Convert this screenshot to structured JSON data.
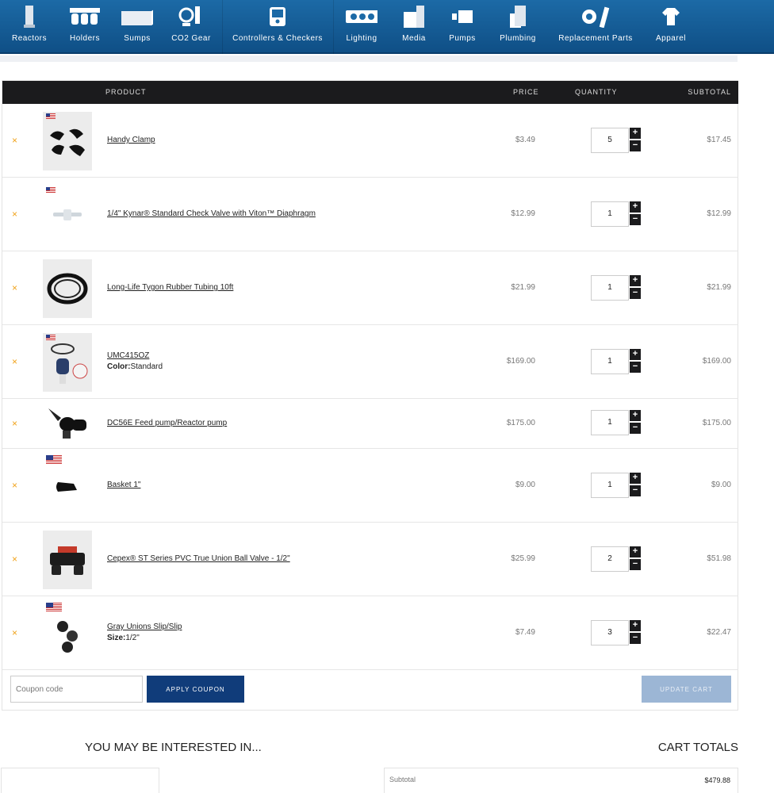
{
  "nav": {
    "items": [
      {
        "label": "Reactors",
        "icon": "reactor-icon"
      },
      {
        "label": "Holders",
        "icon": "holders-icon"
      },
      {
        "label": "Sumps",
        "icon": "sump-icon"
      },
      {
        "label": "CO2 Gear",
        "icon": "co2-gear-icon"
      },
      {
        "label": "Controllers & Checkers",
        "icon": "controller-icon"
      },
      {
        "label": "Lighting",
        "icon": "lighting-icon"
      },
      {
        "label": "Media",
        "icon": "media-icon"
      },
      {
        "label": "Pumps",
        "icon": "pump-icon"
      },
      {
        "label": "Plumbing",
        "icon": "plumbing-icon"
      },
      {
        "label": "Replacement Parts",
        "icon": "replacement-parts-icon"
      },
      {
        "label": "Apparel",
        "icon": "apparel-icon"
      }
    ]
  },
  "table": {
    "headers": {
      "product": "PRODUCT",
      "price": "PRICE",
      "quantity": "QUANTITY",
      "subtotal": "SUBTOTAL"
    },
    "remove_symbol": "×",
    "plus": "+",
    "minus": "−",
    "rows": [
      {
        "name": "Handy Clamp",
        "price": "$3.49",
        "qty": "5",
        "subtotal": "$17.45"
      },
      {
        "name": "1/4\" Kynar® Standard Check Valve with Viton™ Diaphragm",
        "price": "$12.99",
        "qty": "1",
        "subtotal": "$12.99"
      },
      {
        "name": "Long-Life Tygon Rubber Tubing 10ft",
        "price": "$21.99",
        "qty": "1",
        "subtotal": "$21.99"
      },
      {
        "name": "UMC415OZ",
        "attr_label": "Color:",
        "attr_value": "Standard",
        "price": "$169.00",
        "qty": "1",
        "subtotal": "$169.00"
      },
      {
        "name": "DC56E Feed pump/Reactor pump",
        "price": "$175.00",
        "qty": "1",
        "subtotal": "$175.00"
      },
      {
        "name": "Basket 1\"",
        "price": "$9.00",
        "qty": "1",
        "subtotal": "$9.00"
      },
      {
        "name": "Cepex® ST Series PVC True Union Ball Valve - 1/2\"",
        "price": "$25.99",
        "qty": "2",
        "subtotal": "$51.98"
      },
      {
        "name": "Gray Unions Slip/Slip",
        "attr_label": "Size:",
        "attr_value": "1/2\"",
        "price": "$7.49",
        "qty": "3",
        "subtotal": "$22.47"
      }
    ]
  },
  "actions": {
    "coupon_placeholder": "Coupon code",
    "apply_label": "APPLY COUPON",
    "update_label": "UPDATE CART"
  },
  "sections": {
    "interested_title": "YOU MAY BE INTERESTED IN...",
    "totals_title": "CART TOTALS"
  },
  "totals": {
    "subtotal_label": "Subtotal",
    "subtotal_value": "$479.88"
  },
  "colors": {
    "nav_bg": "#1c6aa6",
    "header_bg": "#1b1b1d",
    "apply_button": "#103c7a",
    "update_button_disabled": "#9cb6d5",
    "remove_icon": "#f0a21a"
  }
}
